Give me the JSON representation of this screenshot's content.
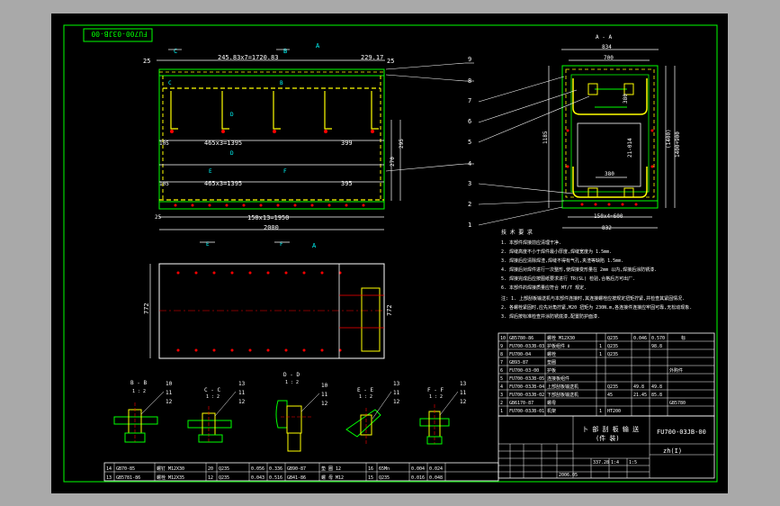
{
  "drawing_number": "FU700-03JB-00",
  "title_block": {
    "drawing_no": "FU700-03JB-00",
    "name_line1": "卜 部 刮 板 输 送",
    "name_line2": "(件 装)",
    "scale": "1:5",
    "weight": "337.28",
    "qty": "1:4",
    "company": "zh(I)",
    "date": "2006.05"
  },
  "dimensions": {
    "top_left": "25",
    "top_span": "245.83x7=1720.83",
    "top_mid": "229.17",
    "top_right": "25",
    "mid1": "465x3=1395",
    "mid1_r": "399",
    "mid2": "465x3=1395",
    "mid2_r": "395",
    "left1": "105",
    "left2": "105",
    "bottom_span": "150x13=1950",
    "total": "2000",
    "left_end": "25",
    "height_a": "270",
    "height_b": "295",
    "plan_height": "772",
    "plan_height_r": "772",
    "end_width_top": "834",
    "end_width_inner": "700",
    "end_width_bottom": "832",
    "end_width_bolt": "150x4=600",
    "end_height": "1185",
    "end_h_inner": "(1400)",
    "end_h2": "1400+900",
    "end_mid": "380",
    "end_mid2": "21-014",
    "end_small": "380"
  },
  "section_labels": {
    "A": "A",
    "B": "B",
    "C": "C",
    "D": "D",
    "E": "E",
    "F": "F",
    "view_aa": "A - A",
    "bb": "B - B",
    "cc": "C - C",
    "dd": "D - D",
    "ee": "E - E",
    "ff": "F - F",
    "scale_12": "1 : 2"
  },
  "callouts": [
    "9",
    "8",
    "7",
    "6",
    "5",
    "4",
    "3",
    "2",
    "1",
    "10",
    "11",
    "12",
    "13"
  ],
  "notes": {
    "heading": "技 术 要 求",
    "lines": [
      "1. 本部件焊接前应清理干净.",
      "2. 焊缝高度不小于焊件最小厚度,焊缝宽度为 1.5mm.",
      "3. 焊接后应清除焊渣,焊缝不得有气孔,夹渣等缺陷 1.5mm.",
      "4. 焊接后对焊件进行一次整形,使焊接变形量在 2mm 以内,焊接后涂防锈漆.",
      "5. 焊接完成后应按图纸要求进行 TR(SL) 检验,合格后方可出厂.",
      "6. 本部件的焊接质量应符合 MT/T 规定.",
      "注: 1. 上部刮板输送机与本部件连接时,其连接螺栓应按规定扭矩拧紧,并检查其紧固情况.",
      "    2. 各螺栓紧固时,应先对角拧紧,M20 扭矩为 230N.m,各连接件连接应牢固可靠,无松动现象.",
      "    3. 焊后按标准检查并涂防锈底漆,配置防护面漆."
    ]
  },
  "bom": [
    {
      "no": "10",
      "code": "GB5780-86",
      "name": "螺栓 M12X30",
      "qty": "",
      "mat": "Q235",
      "w1": "0.046",
      "w2": "0.570",
      "note": "标"
    },
    {
      "no": "9",
      "code": "FU700-03JB-03",
      "name": "护板组件 Ⅱ",
      "qty": "1",
      "mat": "Q235",
      "w1": "",
      "w2": "98.8",
      "note": ""
    },
    {
      "no": "8",
      "code": "FU700-04",
      "name": "螺栓",
      "qty": "1",
      "mat": "Q235",
      "w1": "",
      "w2": "",
      "note": ""
    },
    {
      "no": "7",
      "code": "GB93-87",
      "name": "垫圈",
      "qty": "",
      "mat": "",
      "w1": "",
      "w2": "",
      "note": ""
    },
    {
      "no": "6",
      "code": "FU700-03-00",
      "name": "护板",
      "qty": "",
      "mat": "",
      "w1": "",
      "w2": "",
      "note": "外购件"
    },
    {
      "no": "5",
      "code": "FU700-03JB-05",
      "name": "连接板组件",
      "qty": "",
      "mat": "",
      "w1": "",
      "w2": "",
      "note": ""
    },
    {
      "no": "4",
      "code": "FU700-03JB-04",
      "name": "上部刮板输送机",
      "qty": "",
      "mat": "Q235",
      "w1": "49.8",
      "w2": "49.8",
      "note": ""
    },
    {
      "no": "3",
      "code": "FU700-03JB-02",
      "name": "下部刮板输送机",
      "qty": "",
      "mat": "45",
      "w1": "21.45",
      "w2": "85.8",
      "note": ""
    },
    {
      "no": "2",
      "code": "GB6170-87",
      "name": "螺母",
      "qty": "",
      "mat": "",
      "w1": "",
      "w2": "",
      "note": "GB5780"
    },
    {
      "no": "1",
      "code": "FU700-03JB-01",
      "name": "机架",
      "qty": "1",
      "mat": "HT200",
      "w1": "",
      "w2": "",
      "note": ""
    }
  ],
  "bottom_bom": [
    {
      "no": "14",
      "code": "GB70-85",
      "name": "螺钉 M12X30",
      "no2": "20",
      "mat": "Q235",
      "w": "0.056",
      "tot": "0.336",
      "code2": "GB90-87",
      "name2": "垫 圈 12",
      "no3": "16",
      "mat2": "65Mn",
      "w2": "0.004",
      "tot2": "0.024"
    },
    {
      "no": "13",
      "code": "GB5781-86",
      "name": "螺栓 M12X35",
      "no2": "12",
      "mat": "Q235",
      "w": "0.043",
      "tot": "0.516",
      "code2": "GB41-86",
      "name2": "螺 母 M12",
      "no3": "15",
      "mat2": "Q235",
      "w2": "0.016",
      "tot2": "0.048"
    }
  ],
  "colors": {
    "frame": "#00ff00",
    "line": "#ffffff",
    "accent": "#ffff00",
    "red": "#ff0000",
    "cyan": "#00ffff"
  }
}
